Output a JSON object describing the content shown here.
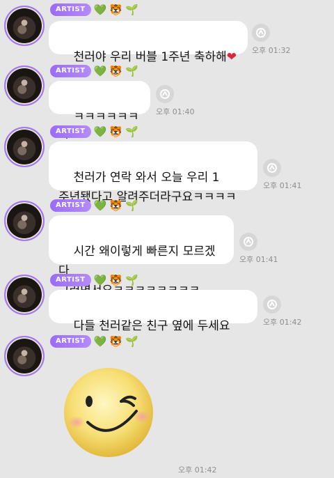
{
  "badge": "ARTIST",
  "emojis": [
    "💚",
    "🐯",
    "🌱"
  ],
  "messages": [
    {
      "text": "천러야 우리 버블 1주년 축하해",
      "suffix": "❤",
      "time": "오후 01:32"
    },
    {
      "text": "ㅋㅋㅋㅋㅋㅋㅋ",
      "time": "오후 01:40"
    },
    {
      "text": "천러가 연락 와서 오늘 우리 1\n주년됐다고 알려주더라구요ㅋㅋㅋㅋ",
      "time": "오후 01:41"
    },
    {
      "text": "시간 왜이렇게 빠른지 모르겠다\n그러면서요ㅋㅋㅋㅋㅋㅋㅋㅋ",
      "time": "오후 01:41"
    },
    {
      "text": "다들 천러같은 친구 옆에 두세요~~~",
      "time": "오후 01:42"
    },
    {
      "sticker": "wink-face",
      "time": "오후 01:42"
    }
  ],
  "colors": {
    "background": "#e6e6e6",
    "bubble": "#ffffff",
    "badge": "#9b6cf5",
    "time": "#8e8e8e"
  }
}
